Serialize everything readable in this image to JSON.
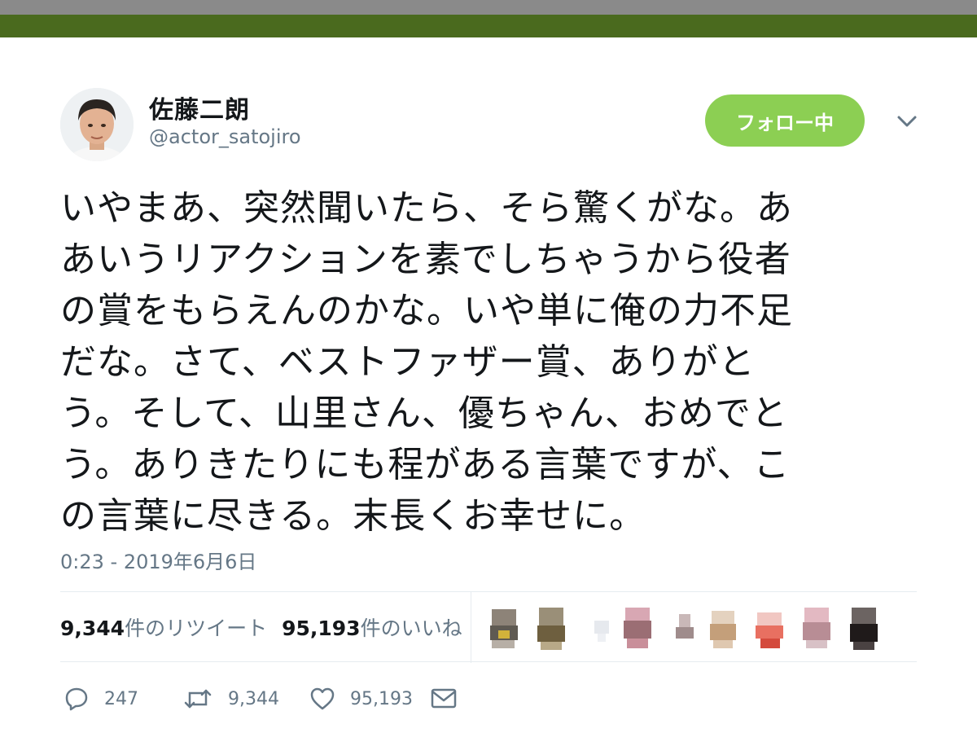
{
  "user": {
    "display_name": "佐藤二朗",
    "handle": "@actor_satojiro"
  },
  "follow_button": {
    "label": "フォロー中",
    "color": "#8ccf53"
  },
  "tweet": {
    "text": "いやまあ、突然聞いたら、そら驚くがな。あ\nあいうリアクションを素でしちゃうから役者\nの賞をもらえんのかな。いや単に俺の力不足\nだな。さて、ベストファザー賞、ありがと\nう。そして、山里さん、優ちゃん、おめでと\nう。ありきたりにも程がある言葉ですが、こ\nの言葉に尽きる。末長くお幸せに。",
    "timestamp": "0:23 - 2019年6月6日"
  },
  "stats": {
    "retweet_count": "9,344",
    "retweet_label": "件のリツイート",
    "like_count": "95,193",
    "like_label": "件のいいね"
  },
  "actions": {
    "reply_count": "247",
    "retweet_count": "9,344",
    "like_count": "95,193"
  },
  "icons": {
    "caret": "chevron-down-icon",
    "reply": "reply-icon",
    "retweet": "retweet-icon",
    "like": "heart-icon",
    "dm": "envelope-icon"
  }
}
